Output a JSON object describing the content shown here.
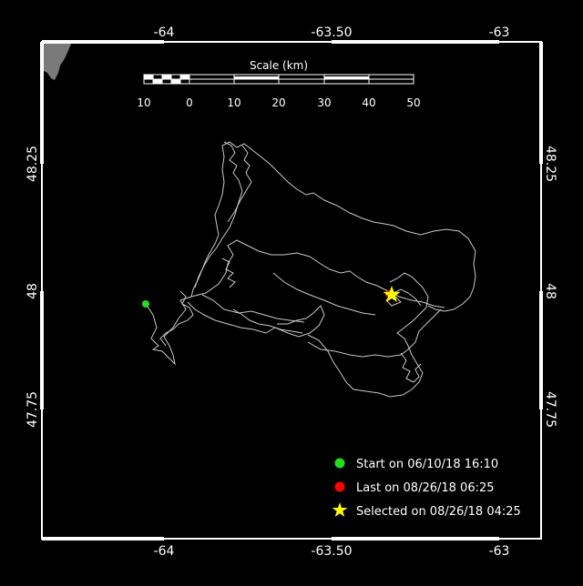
{
  "map": {
    "axis_top": [
      "-64",
      "-63.50",
      "-63"
    ],
    "axis_bottom": [
      "-64",
      "-63.50",
      "-63"
    ],
    "axis_left": [
      "48.25",
      "48",
      "47.75"
    ],
    "axis_right": [
      "48.25",
      "48",
      "47.75"
    ],
    "scale": {
      "title": "Scale (km)",
      "labels": [
        "10",
        "0",
        "10",
        "20",
        "30",
        "40",
        "50"
      ]
    },
    "legend": {
      "start": "Start on 06/10/18 16:10",
      "last": "Last on 08/26/18 06:25",
      "selected": "Selected on 08/26/18 04:25"
    },
    "colors": {
      "background": "#000000",
      "land": "#7a7a7a",
      "track": "#c8c8c8",
      "start": "#22dd22",
      "last": "#ff0000",
      "selected": "#ffff00"
    }
  }
}
